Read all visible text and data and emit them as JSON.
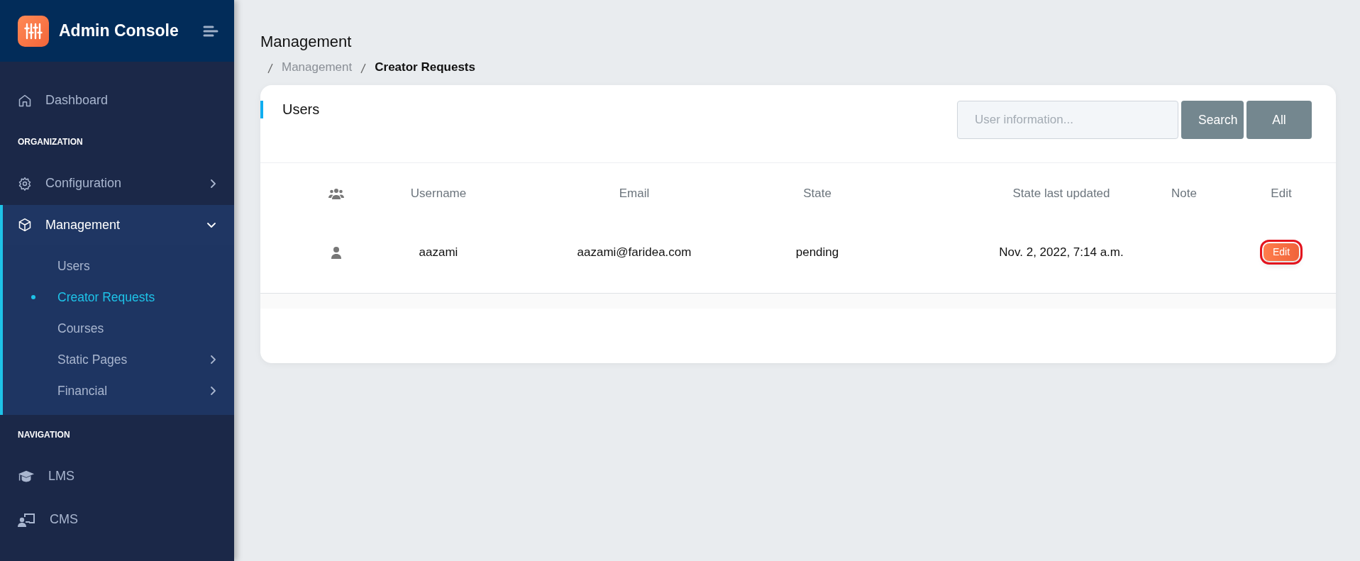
{
  "brand": {
    "title": "Admin Console"
  },
  "sidebar": [
    {
      "kind": "link",
      "label": "Dashboard"
    },
    {
      "kind": "heading",
      "label": "ORGANIZATION"
    },
    {
      "kind": "submenu",
      "label": "Configuration",
      "expanded": false
    },
    {
      "kind": "submenu",
      "label": "Management",
      "expanded": true,
      "children": [
        {
          "kind": "link",
          "label": "Users",
          "selected": false
        },
        {
          "kind": "link",
          "label": "Creator Requests",
          "selected": true
        },
        {
          "kind": "link",
          "label": "Courses",
          "selected": false
        },
        {
          "kind": "submenu",
          "label": "Static Pages",
          "expanded": false,
          "selected": false
        },
        {
          "kind": "submenu",
          "label": "Financial",
          "expanded": false,
          "selected": false
        }
      ]
    },
    {
      "kind": "heading",
      "label": "NAVIGATION"
    },
    {
      "kind": "link",
      "label": "LMS"
    },
    {
      "kind": "link",
      "label": "CMS"
    }
  ],
  "page": {
    "title": "Management",
    "breadcrumb": [
      {
        "label": "Management",
        "current": false
      },
      {
        "label": "Creator Requests",
        "current": true
      }
    ]
  },
  "card": {
    "title": "Users",
    "search": {
      "placeholder": "User information..."
    },
    "buttons": [
      "Search",
      "All"
    ]
  },
  "table": {
    "columns": [
      "Username",
      "Email",
      "State",
      "State last updated",
      "Note",
      "Edit"
    ],
    "rows": [
      {
        "username": "aazami",
        "email": "aazami@faridea.com",
        "state": "pending",
        "updated": "Nov. 2, 2022, 7:14 a.m.",
        "action": "Edit",
        "highlighted": true
      }
    ]
  }
}
